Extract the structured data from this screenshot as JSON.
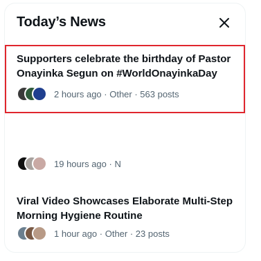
{
  "panel": {
    "title": "Today’s News",
    "close_icon": "close-icon"
  },
  "items": [
    {
      "headline": "Supporters celebrate the birthday of Pastor Onayinka Segun on #WorldOnayinkaDay",
      "meta": "2 hours ago · Other · 563 posts",
      "selected": true,
      "avatar_colors": [
        "#3a3a3a",
        "#2f5a3a",
        "#1f3f8f"
      ]
    },
    {
      "headline": "",
      "meta": "19 hours ago · N",
      "selected": false,
      "avatar_colors": [
        "#111111",
        "#a8a29e",
        "#c9a9a4"
      ]
    },
    {
      "headline": "Viral Video Showcases Elaborate Multi-Step Morning Hygiene Routine",
      "meta": "1 hour ago · Other · 23 posts",
      "selected": false,
      "avatar_colors": [
        "#6b7f8f",
        "#7a5a46",
        "#b89a86"
      ]
    }
  ],
  "colors": {
    "highlight_border": "#e0262d",
    "text_primary": "#0f1419",
    "text_secondary": "#536471"
  }
}
